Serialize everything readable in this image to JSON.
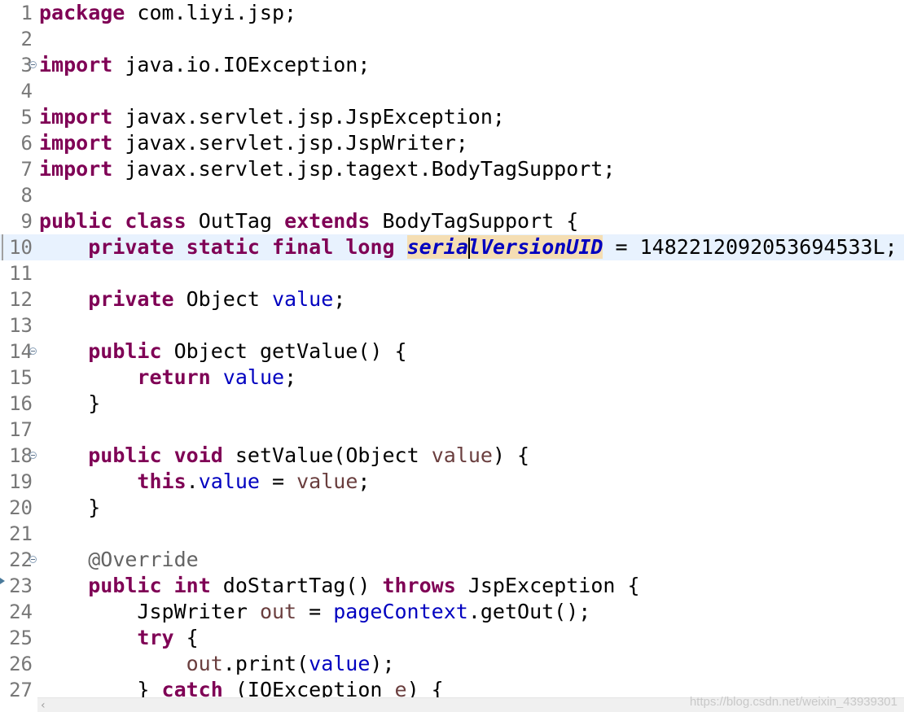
{
  "editor": {
    "lines": [
      {
        "n": "1"
      },
      {
        "n": "2"
      },
      {
        "n": "3"
      },
      {
        "n": "4"
      },
      {
        "n": "5"
      },
      {
        "n": "6"
      },
      {
        "n": "7"
      },
      {
        "n": "8"
      },
      {
        "n": "9"
      },
      {
        "n": "10"
      },
      {
        "n": "11"
      },
      {
        "n": "12"
      },
      {
        "n": "13"
      },
      {
        "n": "14"
      },
      {
        "n": "15"
      },
      {
        "n": "16"
      },
      {
        "n": "17"
      },
      {
        "n": "18"
      },
      {
        "n": "19"
      },
      {
        "n": "20"
      },
      {
        "n": "21"
      },
      {
        "n": "22"
      },
      {
        "n": "23"
      },
      {
        "n": "24"
      },
      {
        "n": "25"
      },
      {
        "n": "26"
      },
      {
        "n": "27"
      }
    ],
    "t": {
      "package": "package",
      "pkg_name": " com.liyi.jsp;",
      "import": "import",
      "imp_io": " java.io.IOException;",
      "imp_jspex": " javax.servlet.jsp.JspException;",
      "imp_writer": " javax.servlet.jsp.JspWriter;",
      "imp_bts": " javax.servlet.jsp.tagext.BodyTagSupport;",
      "public": "public",
      "class": "class",
      "outtag": " OutTag ",
      "extends": "extends",
      "bts_brace": " BodyTagSupport {",
      "private": "private",
      "static": "static",
      "final": "final",
      "long": "long",
      "serial_a": "seria",
      "serial_b": "lVersionUID",
      "serial_val": " = 1482212092053694533L;",
      "object": " Object ",
      "value": "value",
      "semi": ";",
      "getvalue": " Object getValue() {",
      "return": "return",
      "close_brace": "}",
      "void": "void",
      "setvalue_open": " setValue(Object ",
      "paren_brace": ") {",
      "this": "this",
      "dot": ".",
      "assign": " = ",
      "override": "@Override",
      "int": "int",
      "dostart": " doStartTag() ",
      "throws": "throws",
      "jspex_brace": " JspException {",
      "jspwriter": "JspWriter ",
      "out": "out",
      "pagecontext": "pageContext",
      "getout": ".getOut();",
      "try": "try",
      "brace_open": " {",
      "print_open": ".print(",
      "print_close": ");",
      "catch_pre": "} ",
      "catch": "catch",
      "catch_args": " (IOException ",
      "e": "e",
      "catch_end": ") {"
    }
  },
  "scrollbar": {
    "left_arrow": "‹"
  },
  "watermark": "https://blog.csdn.net/weixin_43939301"
}
